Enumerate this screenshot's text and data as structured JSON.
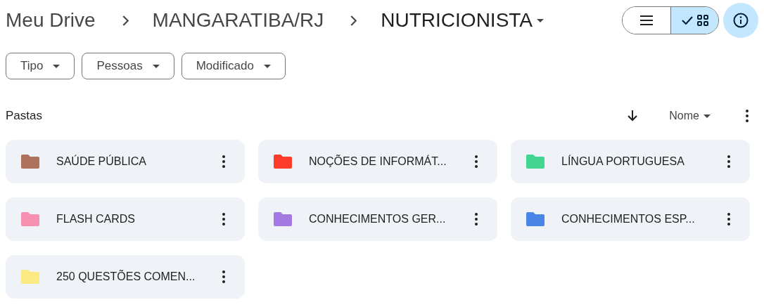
{
  "breadcrumb": [
    {
      "label": "Meu Drive",
      "current": false
    },
    {
      "label": "MANGARATIBA/RJ",
      "current": false
    },
    {
      "label": "NUTRICIONISTA",
      "current": true
    }
  ],
  "view_toggle": [
    {
      "kind": "list",
      "selected": false
    },
    {
      "kind": "grid",
      "selected": true
    }
  ],
  "filters": [
    {
      "label": "Tipo"
    },
    {
      "label": "Pessoas"
    },
    {
      "label": "Modificado"
    }
  ],
  "section": {
    "title": "Pastas",
    "sort_label": "Nome"
  },
  "folders": [
    {
      "name": "SAÚDE PÚBLICA",
      "color": "#ac725e"
    },
    {
      "name": "NOÇÕES DE INFORMÁT...",
      "color": "#fa3c28"
    },
    {
      "name": "LÍNGUA PORTUGUESA",
      "color": "#42d692"
    },
    {
      "name": "FLASH CARDS",
      "color": "#f691b2"
    },
    {
      "name": "CONHECIMENTOS GER...",
      "color": "#a47ae2"
    },
    {
      "name": "CONHECIMENTOS ESP...",
      "color": "#4986e7"
    },
    {
      "name": "250 QUESTÕES COMEN...",
      "color": "#fbe983"
    }
  ]
}
